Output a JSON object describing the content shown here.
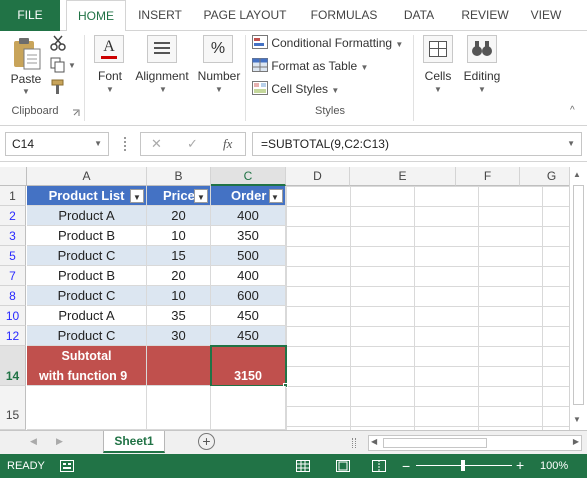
{
  "ribbon_tabs": [
    "FILE",
    "HOME",
    "INSERT",
    "PAGE LAYOUT",
    "FORMULAS",
    "DATA",
    "REVIEW",
    "VIEW"
  ],
  "ribbon": {
    "paste_label": "Paste",
    "clipboard_label": "Clipboard",
    "font_label": "Font",
    "alignment_label": "Alignment",
    "number_label": "Number",
    "conditional_formatting": "Conditional Formatting",
    "format_as_table": "Format as Table",
    "cell_styles": "Cell Styles",
    "styles_label": "Styles",
    "cells_label": "Cells",
    "editing_label": "Editing",
    "font_icon_glyph": "A",
    "number_icon_glyph": "%"
  },
  "formula_bar": {
    "name_box": "C14",
    "formula": "=SUBTOTAL(9,C2:C13)",
    "fx_glyph": "fx",
    "cancel_glyph": "✕",
    "enter_glyph": "✓"
  },
  "columns": [
    "A",
    "B",
    "C",
    "D",
    "E",
    "F",
    "G"
  ],
  "header_row": {
    "row_number": "1",
    "a": "Product List",
    "b": "Price",
    "c": "Order"
  },
  "rows": [
    {
      "row_number": "2",
      "a": "Product A",
      "b": "20",
      "c": "400"
    },
    {
      "row_number": "3",
      "a": "Product B",
      "b": "10",
      "c": "350"
    },
    {
      "row_number": "5",
      "a": "Product C",
      "b": "15",
      "c": "500"
    },
    {
      "row_number": "7",
      "a": "Product B",
      "b": "20",
      "c": "400"
    },
    {
      "row_number": "8",
      "a": "Product C",
      "b": "10",
      "c": "600"
    },
    {
      "row_number": "10",
      "a": "Product A",
      "b": "35",
      "c": "450"
    },
    {
      "row_number": "12",
      "a": "Product C",
      "b": "30",
      "c": "450"
    }
  ],
  "subtotal_row": {
    "row_number": "14",
    "label_line1": "Subtotal",
    "label_line2": "with function 9",
    "value": "3150"
  },
  "empty_row": {
    "row_number": "15"
  },
  "sheet_tabs": [
    "Sheet1"
  ],
  "status": {
    "ready": "READY",
    "zoom": "100%",
    "zoom_fraction": 0.5
  },
  "colors": {
    "accent": "#217346",
    "table_header": "#4472c4",
    "band": "#dce6f1",
    "subtotal": "#c0504d"
  }
}
